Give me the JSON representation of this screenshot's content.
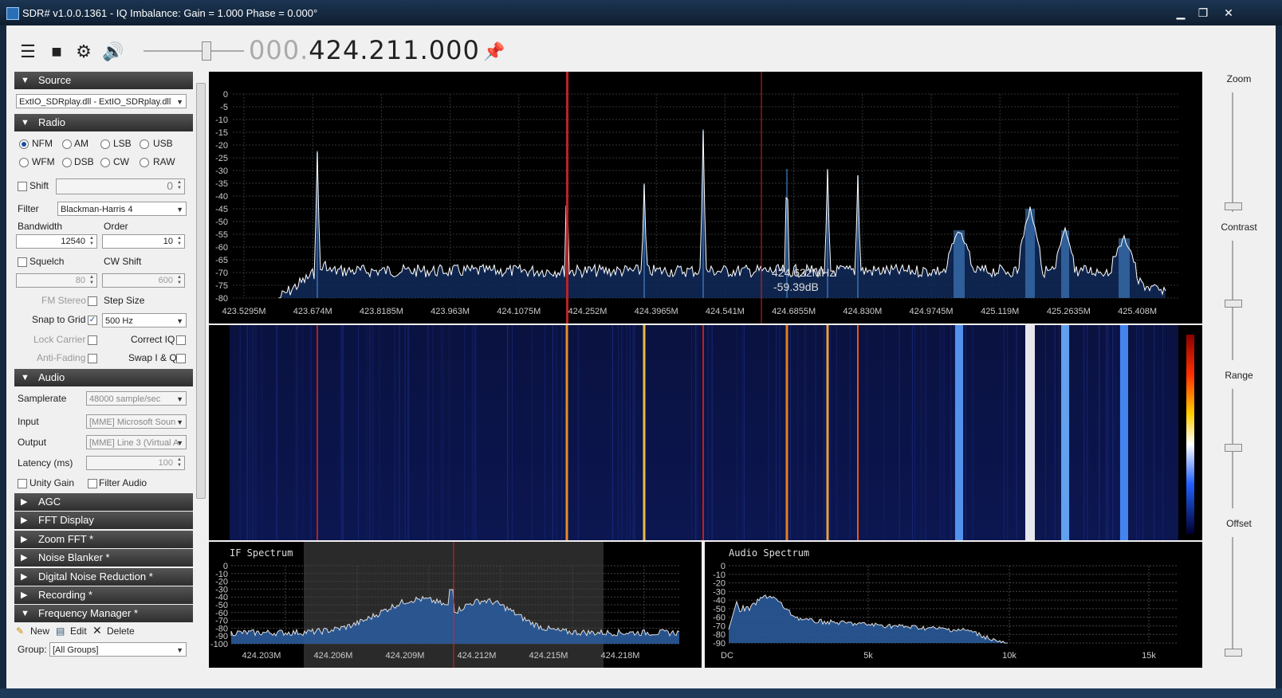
{
  "window": {
    "title": "SDR# v1.0.0.1361 - IQ Imbalance: Gain = 1.000 Phase = 0.000°",
    "min": "▁",
    "max": "❐",
    "close": "✕"
  },
  "toolbar": {
    "freq_dim": "000.",
    "freq_main": "424.211.000"
  },
  "source": {
    "header": "Source",
    "device": "ExtIO_SDRplay.dll - ExtIO_SDRplay.dll"
  },
  "radio": {
    "header": "Radio",
    "modes": [
      "NFM",
      "AM",
      "LSB",
      "USB",
      "WFM",
      "DSB",
      "CW",
      "RAW"
    ],
    "selected": "NFM",
    "shift_label": "Shift",
    "shift_value": "0",
    "filter_label": "Filter",
    "filter_value": "Blackman-Harris 4",
    "bandwidth_label": "Bandwidth",
    "bandwidth_value": "12540",
    "order_label": "Order",
    "order_value": "10",
    "squelch_label": "Squelch",
    "squelch_value": "80",
    "cwshift_label": "CW Shift",
    "cwshift_value": "600",
    "fmstereo_label": "FM Stereo",
    "stepsize_label": "Step Size",
    "snap_label": "Snap to Grid",
    "step_value": "500 Hz",
    "lockcarrier_label": "Lock Carrier",
    "correctiq_label": "Correct IQ",
    "antifading_label": "Anti-Fading",
    "swapiq_label": "Swap I & Q"
  },
  "audio": {
    "header": "Audio",
    "samplerate_label": "Samplerate",
    "samplerate_value": "48000 sample/sec",
    "input_label": "Input",
    "input_value": "[MME] Microsoft Soun",
    "output_label": "Output",
    "output_value": "[MME] Line 3 (Virtual A",
    "latency_label": "Latency (ms)",
    "latency_value": "100",
    "unity_label": "Unity Gain",
    "filteraudio_label": "Filter Audio"
  },
  "collapsed_sections": [
    "AGC",
    "FFT Display",
    "Zoom FFT *",
    "Noise Blanker *",
    "Digital Noise Reduction *",
    "Recording *"
  ],
  "freq_manager": {
    "header": "Frequency Manager *",
    "new": "New",
    "edit": "Edit",
    "delete": "Delete",
    "group_label": "Group:",
    "group_value": "[All Groups]"
  },
  "spectrum": {
    "y_labels": [
      "0",
      "-5",
      "-10",
      "-15",
      "-20",
      "-25",
      "-30",
      "-35",
      "-40",
      "-45",
      "-50",
      "-55",
      "-60",
      "-65",
      "-70",
      "-75",
      "-80"
    ],
    "x_labels": [
      "423.5295M",
      "423.674M",
      "423.8185M",
      "423.963M",
      "424.1075M",
      "424.252M",
      "424.3965M",
      "424.541M",
      "424.6855M",
      "424.830M",
      "424.9745M",
      "425.119M",
      "425.2635M",
      "425.408M"
    ],
    "cursor_freq": "424.622MHz",
    "cursor_db": "-59.39dB",
    "accent": "#4a8fd8"
  },
  "if_spectrum": {
    "title": "IF Spectrum",
    "y_labels": [
      "0",
      "-10",
      "-20",
      "-30",
      "-40",
      "-50",
      "-60",
      "-70",
      "-80",
      "-90",
      "-100"
    ],
    "x_labels": [
      "424.203M",
      "424.206M",
      "424.209M",
      "424.212M",
      "424.215M",
      "424.218M"
    ]
  },
  "audio_spectrum": {
    "title": "Audio Spectrum",
    "y_labels": [
      "0",
      "-10",
      "-20",
      "-30",
      "-40",
      "-50",
      "-60",
      "-70",
      "-80",
      "-90"
    ],
    "x_labels": [
      "DC",
      "5k",
      "10k",
      "15k"
    ]
  },
  "right_panel": {
    "zoom": "Zoom",
    "contrast": "Contrast",
    "range": "Range",
    "offset": "Offset"
  }
}
